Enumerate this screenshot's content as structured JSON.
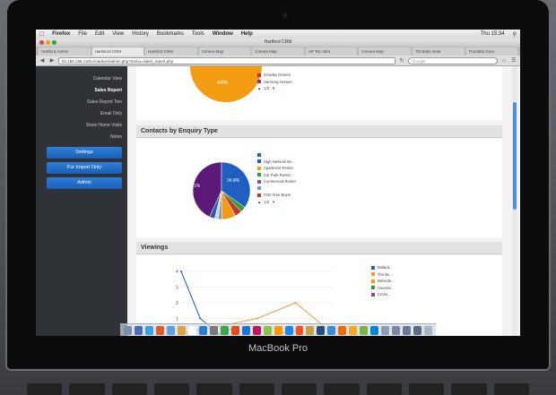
{
  "menubar": {
    "apple": "",
    "items": [
      "Firefox",
      "File",
      "Edit",
      "View",
      "History",
      "Bookmarks",
      "Tools",
      "Window",
      "Help"
    ],
    "clock": "Thu 15:34"
  },
  "window": {
    "title": "Hartford CRM"
  },
  "tabs": [
    "Hartford Admin",
    "HartBord CRM",
    "Hartford CRM",
    "Crimea Map",
    "Crimea Map",
    "UP Tec Infra",
    "Crimea Map",
    "Thorlabs Gear",
    "Thorlabs Gear"
  ],
  "navbar": {
    "url": "82.165.198.110/crmadmin/admin.php?menu=sales_report.php",
    "search_placeholder": "Google"
  },
  "sidebar": {
    "links": [
      "Calendar View",
      "Sales Report",
      "Sales Report Two",
      "Email Only",
      "Show Home Visits",
      "Notes"
    ],
    "buttons": [
      "Settings",
      "For Import Only",
      "Admin"
    ]
  },
  "top_pie": {
    "label": "44%",
    "legend": [
      {
        "label": "Crowley Groves",
        "color": "#d62728"
      },
      {
        "label": "Harmony Homes",
        "color": "#9c27b0"
      }
    ],
    "pager": "1/3"
  },
  "sections": {
    "enquiry": "Contacts by Enquiry Type",
    "viewings": "Viewings"
  },
  "enquiry_pie": {
    "big_label": "43.1%",
    "small_label": "34.8%",
    "legend": [
      {
        "label": "",
        "color": "#1f5fc2"
      },
      {
        "label": "High Network Bu...",
        "color": "#1f5fc2"
      },
      {
        "label": "Apartment Renter",
        "color": "#f39c12"
      },
      {
        "label": "Car Park Renter",
        "color": "#2ca02c"
      },
      {
        "label": "Commercial Renter",
        "color": "#8e44ad"
      },
      {
        "label": "",
        "color": "#7a9cc8"
      },
      {
        "label": "First Time Buyer",
        "color": "#c0392b"
      }
    ],
    "pager": "1/3"
  },
  "chart_data": [
    {
      "type": "pie",
      "title": "Contacts by Enquiry Type",
      "slices": [
        {
          "label": "High Network Bu...",
          "value": 34.8,
          "color": "#1f5fc2"
        },
        {
          "label": "Car Park Renter",
          "value": 3,
          "color": "#2ca02c"
        },
        {
          "label": "First Time Buyer",
          "value": 4,
          "color": "#c0392b"
        },
        {
          "label": "Apartment Renter",
          "value": 8,
          "color": "#f39c12"
        },
        {
          "label": "",
          "value": 2,
          "color": "#7a9cc8"
        },
        {
          "label": "",
          "value": 2,
          "color": "#d0d0d0"
        },
        {
          "label": "",
          "value": 3,
          "color": "#2e5aa8"
        },
        {
          "label": "Commercial Renter",
          "value": 43.1,
          "color": "#5c1a78"
        }
      ]
    },
    {
      "type": "line",
      "title": "Viewings",
      "ylim": [
        0,
        4
      ],
      "yticks": [
        4,
        3,
        2,
        1
      ],
      "series": [
        {
          "name": "Bullard...",
          "color": "#1f5fc2",
          "points": [
            [
              0,
              4
            ],
            [
              1,
              1
            ],
            [
              2,
              0
            ]
          ]
        },
        {
          "name": "The Be...",
          "color": "#e8a03a",
          "points": [
            [
              0,
              0
            ],
            [
              4,
              1
            ],
            [
              6,
              2
            ],
            [
              8,
              0
            ]
          ]
        },
        {
          "name": "Belvede...",
          "color": "#f39c12",
          "points": [
            [
              0,
              0
            ],
            [
              1,
              0.3
            ]
          ]
        },
        {
          "name": "Cavend...",
          "color": "#2ca02c",
          "points": [
            [
              2,
              0
            ],
            [
              3,
              0.5
            ]
          ]
        },
        {
          "name": "Crons...",
          "color": "#8e44ad",
          "points": [
            [
              5,
              0
            ],
            [
              6,
              0.2
            ]
          ]
        }
      ]
    }
  ],
  "dock_colors": [
    "#7c8ea8",
    "#4a6fb5",
    "#3da0e0",
    "#e05a2b",
    "#5fa1e8",
    "#d9a441",
    "#ffffff",
    "#2a7ed6",
    "#7a7a7a",
    "#36a64f",
    "#e64a19",
    "#1976d2",
    "#c2185b",
    "#8bc34a",
    "#ff9800",
    "#1e88e5",
    "#f4511e",
    "#c6a14b",
    "#2b4c7e",
    "#3b8cd9",
    "#ef6c00",
    "#f9a825",
    "#7cb342",
    "#0288d1",
    "#8d9db6",
    "#7a8aa3",
    "#6b7a94",
    "#5d6b84",
    "#aab4c6"
  ],
  "device": {
    "brand": "MacBook Pro"
  }
}
